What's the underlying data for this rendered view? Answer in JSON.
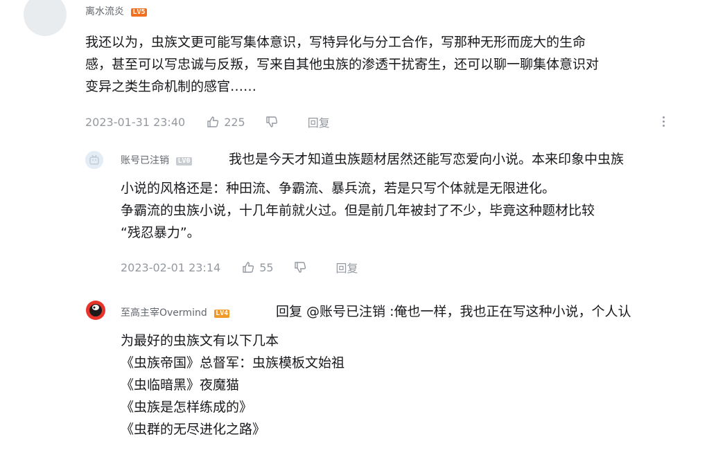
{
  "comment": {
    "username": "离水流炎",
    "level": "LV5",
    "lines": [
      "我还以为，虫族文更可能写集体意识，写特异化与分工合作，写那种无形而庞大的生命",
      "感，甚至可以写忠诚与反叛，写来自其他虫族的渗透干扰寄生，还可以聊一聊集体意识对",
      "变异之类生命机制的感官……"
    ],
    "time": "2023-01-31 23:40",
    "likes": "225",
    "reply_label": "回复"
  },
  "replies": [
    {
      "username": "账号已注销",
      "level": "LV0",
      "lines": [
        "我也是今天才知道虫族题材居然还能写恋爱向小说。本来印象中虫族",
        "小说的风格还是：种田流、争霸流、暴兵流，若是只写个体就是无限进化。",
        "争霸流的虫族小说，十几年前就火过。但是前几年被封了不少，毕竟这种题材比较",
        "“残忍暴力”。"
      ],
      "time": "2023-02-01 23:14",
      "likes": "55",
      "reply_label": "回复"
    },
    {
      "username": "至高主宰Overmind",
      "level": "LV4",
      "reply_prefix": "回复 @账号已注销 :",
      "first_line": "俺也一样，我也正在写这种小说，个人认",
      "lines": [
        "为最好的虫族文有以下几本",
        "《虫族帝国》总督军：虫族模板文始祖",
        "《虫临暗黑》夜魔猫",
        "《虫族是怎样练成的》",
        "《虫群的无尽进化之路》"
      ]
    }
  ],
  "colors": {
    "text": "#18191c",
    "meta": "#9499a0",
    "name": "#61666d"
  }
}
